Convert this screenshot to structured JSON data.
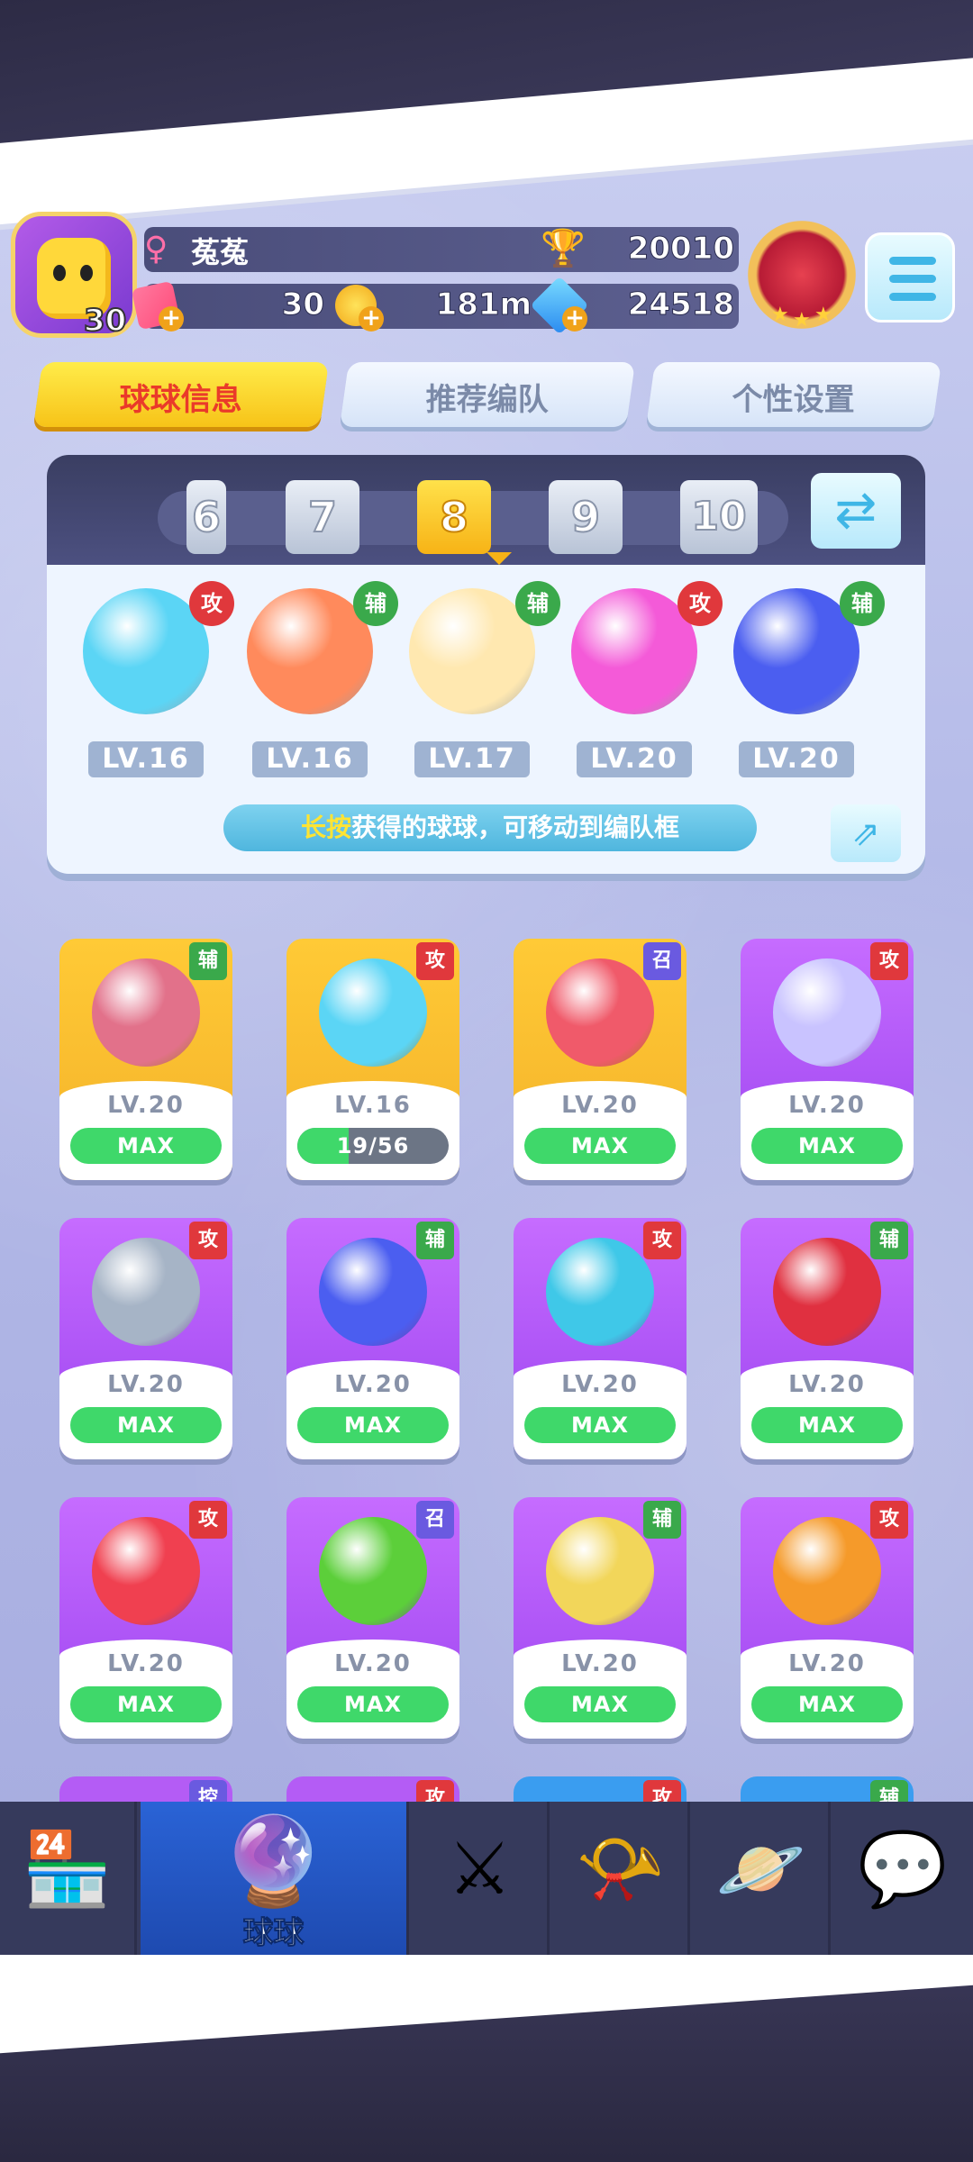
{
  "header": {
    "avatar_level": "30",
    "player_name": "菟菟",
    "trophies": "20010",
    "tickets": "30",
    "energy": "181m",
    "diamonds": "24518"
  },
  "tabs": [
    {
      "label": "球球信息",
      "active": true
    },
    {
      "label": "推荐编队",
      "active": false
    },
    {
      "label": "个性设置",
      "active": false
    }
  ],
  "team": {
    "slots": [
      "6",
      "7",
      "8",
      "9",
      "10"
    ],
    "selected_slot": "8",
    "balls": [
      {
        "tag": "攻",
        "tag_type": "atk",
        "level": "LV.16",
        "color": "#5bd5f5"
      },
      {
        "tag": "辅",
        "tag_type": "sup",
        "level": "LV.16",
        "color": "#ff8a5c"
      },
      {
        "tag": "辅",
        "tag_type": "sup",
        "level": "LV.17",
        "color": "#ffe8b0"
      },
      {
        "tag": "攻",
        "tag_type": "atk",
        "level": "LV.20",
        "color": "#f45ad8"
      },
      {
        "tag": "辅",
        "tag_type": "sup",
        "level": "LV.20",
        "color": "#4b5ef0"
      }
    ],
    "hint_strong": "长按",
    "hint_text": "获得的球球，可移动到编队框"
  },
  "balls": [
    {
      "tag": "辅",
      "tag_type": "sup",
      "level": "LV.20",
      "status": "MAX",
      "card": "gold",
      "color": "#e2718a"
    },
    {
      "tag": "攻",
      "tag_type": "atk",
      "level": "LV.16",
      "status": "19/56",
      "progress": 0.34,
      "card": "gold",
      "color": "#5bd5f5"
    },
    {
      "tag": "召",
      "tag_type": "sum",
      "level": "LV.20",
      "status": "MAX",
      "card": "gold",
      "color": "#f05a6a"
    },
    {
      "tag": "攻",
      "tag_type": "atk",
      "level": "LV.20",
      "status": "MAX",
      "card": "purple",
      "color": "#c9c3ff"
    },
    {
      "tag": "攻",
      "tag_type": "atk",
      "level": "LV.20",
      "status": "MAX",
      "card": "purple",
      "color": "#a6b4c6"
    },
    {
      "tag": "辅",
      "tag_type": "sup",
      "level": "LV.20",
      "status": "MAX",
      "card": "purple",
      "color": "#4b5ef0"
    },
    {
      "tag": "攻",
      "tag_type": "atk",
      "level": "LV.20",
      "status": "MAX",
      "card": "purple",
      "color": "#3fc8e8"
    },
    {
      "tag": "辅",
      "tag_type": "sup",
      "level": "LV.20",
      "status": "MAX",
      "card": "purple",
      "color": "#e03040"
    },
    {
      "tag": "攻",
      "tag_type": "atk",
      "level": "LV.20",
      "status": "MAX",
      "card": "purple",
      "color": "#f04050"
    },
    {
      "tag": "召",
      "tag_type": "sum",
      "level": "LV.20",
      "status": "MAX",
      "card": "purple",
      "color": "#5ccf3a"
    },
    {
      "tag": "辅",
      "tag_type": "sup",
      "level": "LV.20",
      "status": "MAX",
      "card": "purple",
      "color": "#f2d65a"
    },
    {
      "tag": "攻",
      "tag_type": "atk",
      "level": "LV.20",
      "status": "MAX",
      "card": "purple",
      "color": "#f59a2a"
    }
  ],
  "peek_tags": [
    {
      "tag": "控",
      "tag_type": "sum"
    },
    {
      "tag": "攻",
      "tag_type": "atk"
    },
    {
      "tag": "攻",
      "tag_type": "atk"
    },
    {
      "tag": "辅",
      "tag_type": "sup"
    }
  ],
  "nav": [
    {
      "icon": "shop-icon",
      "label": "",
      "active": false
    },
    {
      "icon": "ball-icon",
      "label": "球球",
      "active": true
    },
    {
      "icon": "swords-icon",
      "label": "",
      "active": false
    },
    {
      "icon": "whistle-icon",
      "label": "",
      "active": false
    },
    {
      "icon": "planet-icon",
      "label": "",
      "active": false
    },
    {
      "icon": "chat-icon",
      "label": "",
      "active": false
    }
  ]
}
